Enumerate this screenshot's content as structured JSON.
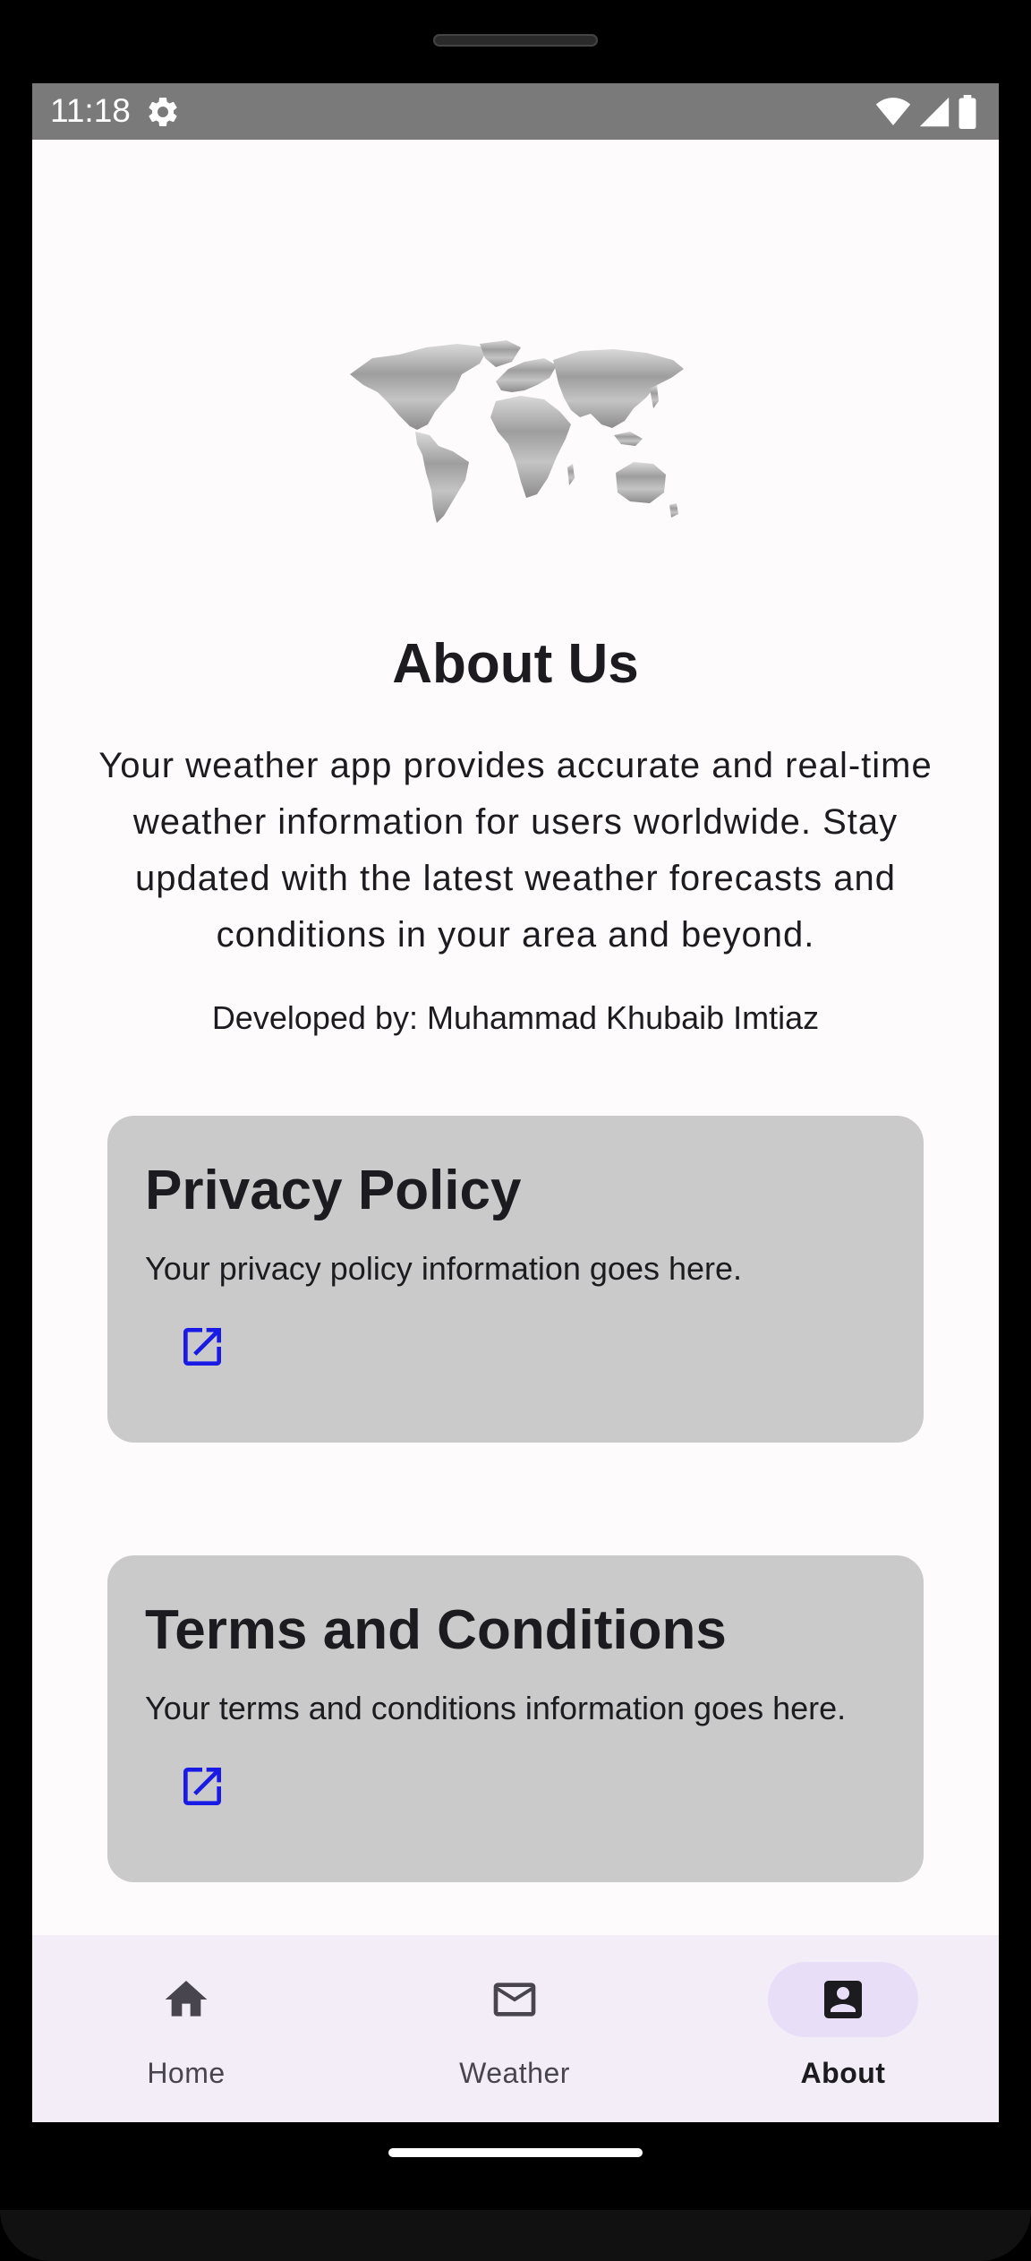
{
  "status_bar": {
    "time": "11:18",
    "icons": [
      "settings-gear-icon",
      "wifi-icon",
      "cellular-signal-icon",
      "battery-icon"
    ]
  },
  "about": {
    "title": "About Us",
    "description": "Your weather app provides accurate and real-time weather information for users worldwide. Stay updated with the latest weather forecasts and conditions in your area and beyond.",
    "developer": "Developed by: Muhammad Khubaib Imtiaz",
    "image_icon": "world-map-icon"
  },
  "cards": {
    "privacy": {
      "title": "Privacy Policy",
      "text": "Your privacy policy information goes here.",
      "link_icon": "open-in-new-icon"
    },
    "terms": {
      "title": "Terms and Conditions",
      "text": "Your terms and conditions information goes here.",
      "link_icon": "open-in-new-icon"
    }
  },
  "bottom_nav": {
    "items": [
      {
        "label": "Home",
        "icon": "home-icon",
        "selected": false
      },
      {
        "label": "Weather",
        "icon": "mail-icon",
        "selected": false
      },
      {
        "label": "About",
        "icon": "account-box-icon",
        "selected": true
      }
    ]
  },
  "colors": {
    "card_bg": "#cacaca",
    "link_icon": "#1a1ae6",
    "nav_bg": "#f2edf6",
    "nav_selected_pill": "#e8def8",
    "status_bar_bg": "#7a7a7a"
  }
}
